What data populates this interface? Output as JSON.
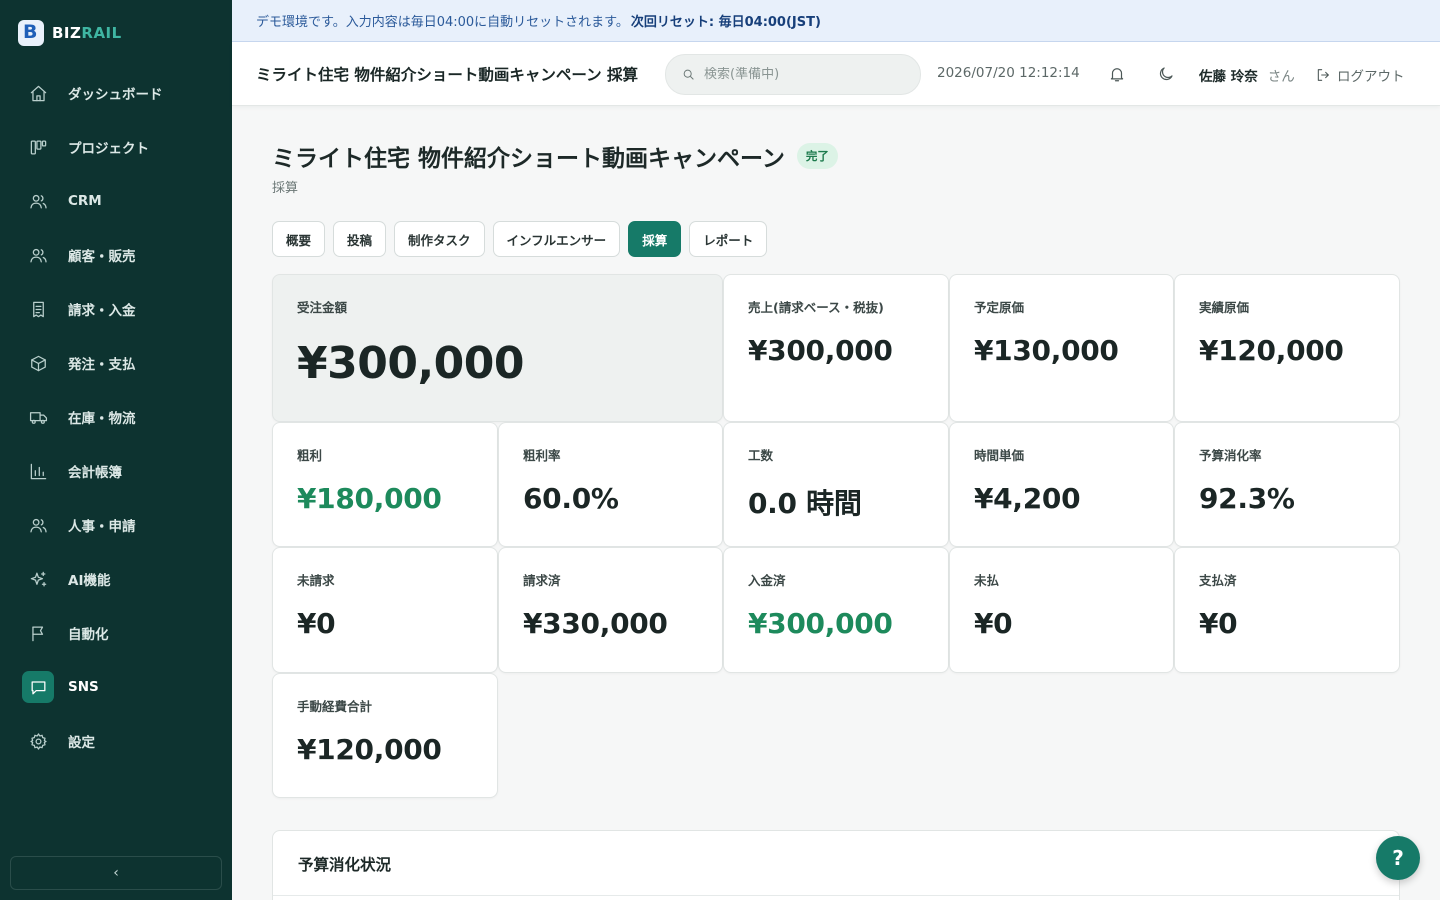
{
  "brand": {
    "part1": "BIZ",
    "part2": "RAIL"
  },
  "sidebar": {
    "items": [
      {
        "label": "ダッシュボード",
        "icon": "home-icon"
      },
      {
        "label": "プロジェクト",
        "icon": "kanban-icon"
      },
      {
        "label": "CRM",
        "icon": "users-icon"
      },
      {
        "label": "顧客・販売",
        "icon": "users-icon"
      },
      {
        "label": "請求・入金",
        "icon": "receipt-icon"
      },
      {
        "label": "発注・支払",
        "icon": "box-icon"
      },
      {
        "label": "在庫・物流",
        "icon": "truck-icon"
      },
      {
        "label": "会計帳簿",
        "icon": "bar-chart-icon"
      },
      {
        "label": "人事・申請",
        "icon": "users-icon"
      },
      {
        "label": "AI機能",
        "icon": "sparkle-icon"
      },
      {
        "label": "自動化",
        "icon": "flag-icon"
      },
      {
        "label": "SNS",
        "icon": "message-icon",
        "active": true
      },
      {
        "label": "設定",
        "icon": "gear-icon"
      }
    ],
    "collapse_glyph": "‹"
  },
  "banner": {
    "text": "デモ環境です。入力内容は毎日04:00に自動リセットされます。",
    "emphasis": "次回リセット: 毎日04:00(JST)"
  },
  "topbar": {
    "title": "ミライト住宅 物件紹介ショート動画キャンペーン 採算",
    "search_placeholder": "検索(準備中)",
    "datetime": "2026/07/20 12:12:14",
    "user_name": "佐藤 玲奈",
    "user_suffix": "さん",
    "logout_label": "ログアウト"
  },
  "page": {
    "title": "ミライト住宅 物件紹介ショート動画キャンペーン",
    "status_badge": "完了",
    "subtitle": "採算"
  },
  "tabs": [
    {
      "label": "概要"
    },
    {
      "label": "投稿"
    },
    {
      "label": "制作タスク"
    },
    {
      "label": "インフルエンサー"
    },
    {
      "label": "採算",
      "active": true
    },
    {
      "label": "レポート"
    }
  ],
  "metrics": {
    "order_amount": {
      "label": "受注金額",
      "value": "¥300,000"
    },
    "sales": {
      "label": "売上(請求ベース・税抜)",
      "value": "¥300,000"
    },
    "planned_cost": {
      "label": "予定原価",
      "value": "¥130,000"
    },
    "actual_cost": {
      "label": "実績原価",
      "value": "¥120,000"
    },
    "gross_profit": {
      "label": "粗利",
      "value": "¥180,000"
    },
    "gross_margin": {
      "label": "粗利率",
      "value": "60.0%"
    },
    "man_hours": {
      "label": "工数",
      "value": "0.0 時間"
    },
    "hourly_rate": {
      "label": "時間単価",
      "value": "¥4,200"
    },
    "budget_rate": {
      "label": "予算消化率",
      "value": "92.3%"
    },
    "unbilled": {
      "label": "未請求",
      "value": "¥0"
    },
    "billed": {
      "label": "請求済",
      "value": "¥330,000"
    },
    "received": {
      "label": "入金済",
      "value": "¥300,000"
    },
    "unpaid": {
      "label": "未払",
      "value": "¥0"
    },
    "paid": {
      "label": "支払済",
      "value": "¥0"
    },
    "manual_expenses": {
      "label": "手動経費合計",
      "value": "¥120,000"
    }
  },
  "budget_section": {
    "title": "予算消化状況"
  },
  "help": {
    "label": "?"
  },
  "colors": {
    "sidebar_bg": "#0d3330",
    "accent": "#167a68",
    "positive": "#1d8a5c",
    "banner_bg": "#e8f0fb"
  }
}
